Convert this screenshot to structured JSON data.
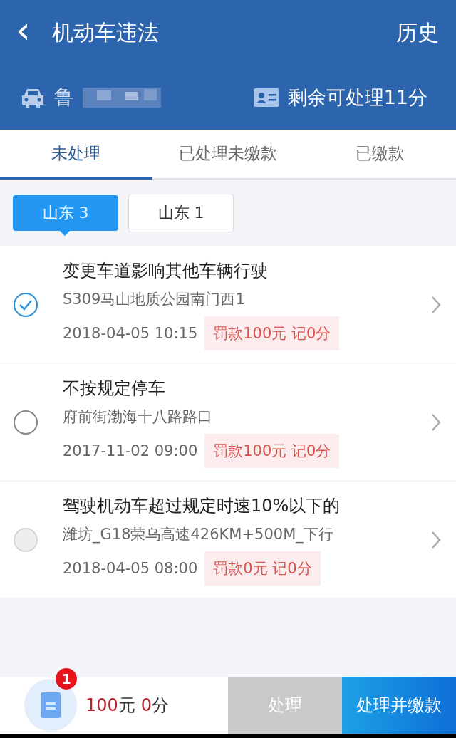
{
  "header": {
    "title": "机动车违法",
    "back": "‹",
    "history": "历史",
    "plate": "鲁",
    "points_left": "剩余可处理11分"
  },
  "tabs": [
    {
      "label": "未处理",
      "selected": true
    },
    {
      "label": "已处理未缴款",
      "selected": false
    },
    {
      "label": "已缴款",
      "selected": false
    }
  ],
  "regions": [
    {
      "label": "山东 3",
      "selected": true
    },
    {
      "label": "山东 1",
      "selected": false
    }
  ],
  "violations": [
    {
      "title": "变更车道影响其他车辆行驶",
      "place": "S309马山地质公园南门西1",
      "time": "2018-04-05 10:15",
      "penalty": "罚款100元 记0分",
      "checked": true,
      "disabled": false
    },
    {
      "title": "不按规定停车",
      "place": "府前街渤海十八路路口",
      "time": "2017-11-02 09:00",
      "penalty": "罚款100元 记0分",
      "checked": false,
      "disabled": false
    },
    {
      "title": "驾驶机动车超过规定时速10%以下的",
      "place": "潍坊_G18荣乌高速426KM+500M_下行",
      "time": "2018-04-05 08:00",
      "penalty": "罚款0元 记0分",
      "checked": false,
      "disabled": true
    }
  ],
  "footer": {
    "badge": "1",
    "amount": "100",
    "amount_unit": "元",
    "points": "0",
    "points_unit": "分",
    "process_button": "处理",
    "pay_button": "处理并缴款"
  }
}
